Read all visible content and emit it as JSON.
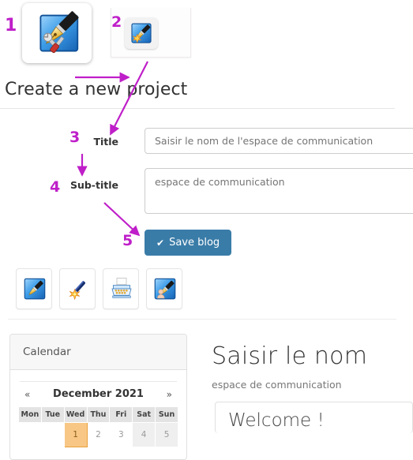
{
  "page": {
    "heading": "Create a new project"
  },
  "top_strip": {
    "icon1": {
      "name": "pen-tools-icon",
      "label": "1"
    },
    "icon2": {
      "name": "pen-sparkle-icon",
      "label": "2"
    }
  },
  "form": {
    "title_label": "Title",
    "title_placeholder": "Saisir le nom de l'espace de communication",
    "subtitle_label": "Sub-title",
    "subtitle_placeholder": "espace de communication",
    "save_label": "Save blog",
    "save_check": "✔",
    "save_color": "#3a7ca8"
  },
  "toolbar": {
    "icons": [
      {
        "name": "blue-pen-icon"
      },
      {
        "name": "magic-wand-icon"
      },
      {
        "name": "typewriter-icon"
      },
      {
        "name": "pen-author-icon"
      }
    ]
  },
  "calendar": {
    "panel_title": "Calendar",
    "prev": "«",
    "next": "»",
    "month": "December 2021",
    "weekdays": [
      "Mon",
      "Tue",
      "Wed",
      "Thu",
      "Fri",
      "Sat",
      "Sun"
    ],
    "rows": [
      [
        {
          "day": "",
          "kind": "empty"
        },
        {
          "day": "",
          "kind": "empty"
        },
        {
          "day": "1",
          "kind": "today"
        },
        {
          "day": "2",
          "kind": "day"
        },
        {
          "day": "3",
          "kind": "day"
        },
        {
          "day": "4",
          "kind": "weekend"
        },
        {
          "day": "5",
          "kind": "weekend"
        }
      ]
    ],
    "highlight_color": "#f8c785"
  },
  "preview": {
    "title": "Saisir le nom",
    "subtitle": "espace de communication",
    "card_text": "Welcome !"
  },
  "annotations": {
    "color": "#bf1fc9",
    "numbers": [
      "1",
      "2",
      "3",
      "4",
      "5"
    ]
  }
}
